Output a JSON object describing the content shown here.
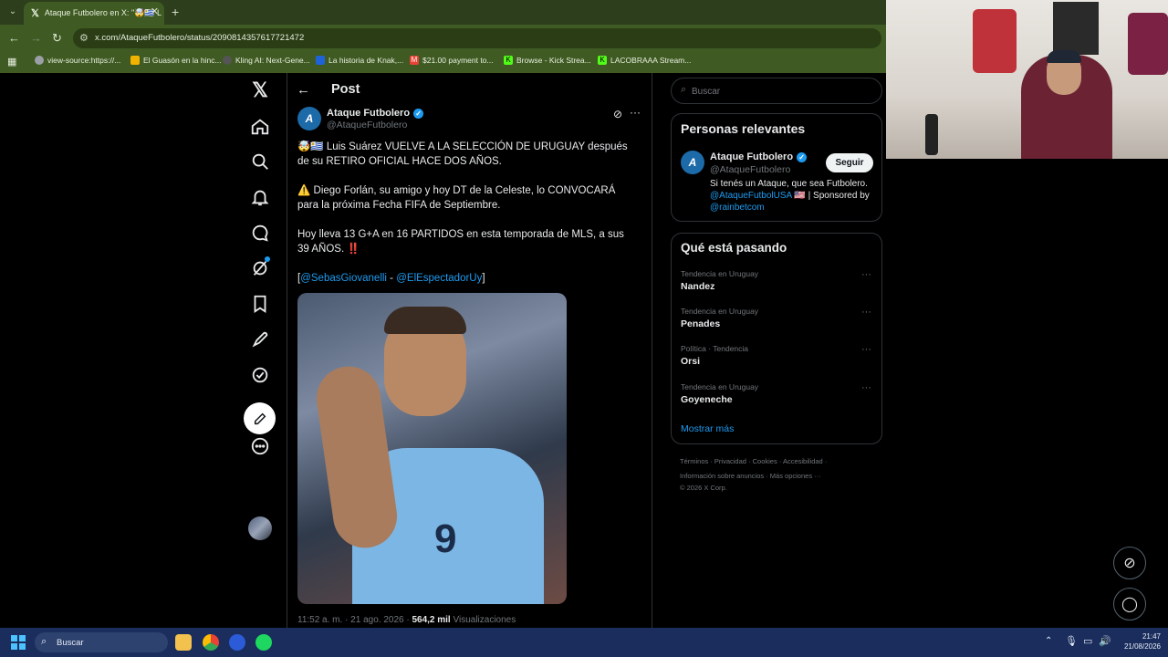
{
  "browser": {
    "tab_title": "Ataque Futbolero en X: \"🤯🇺🇾 L",
    "url": "x.com/AtaqueFutbolero/status/2090814357617721472",
    "bookmarks": [
      {
        "label": "view-source:https://...",
        "icon_color": "#9aa0a6"
      },
      {
        "label": "El Guasón en la hinc...",
        "icon_color": "#f0b400"
      },
      {
        "label": "Kling AI: Next-Gene...",
        "icon_color": "#e8eaed"
      },
      {
        "label": "La historia de Knak,...",
        "icon_color": "#1e63d8"
      },
      {
        "label": "$21.00 payment to...",
        "icon_color": "#ea4335"
      },
      {
        "label": "Browse - Kick Strea...",
        "icon_color": "#53fc18"
      },
      {
        "label": "LACOBRAAA Stream...",
        "icon_color": "#53fc18"
      }
    ]
  },
  "post_header": {
    "title": "Post"
  },
  "author": {
    "name": "Ataque Futbolero",
    "handle": "@AtaqueFutbolero",
    "avatar_initial": "A"
  },
  "post": {
    "line1": "🤯🇺🇾 Luis Suárez VUELVE A LA SELECCIÓN DE URUGUAY después de su RETIRO OFICIAL HACE DOS AÑOS.",
    "line2": "⚠️ Diego Forlán, su amigo y hoy DT de la Celeste, lo CONVOCARÁ para la próxima Fecha FIFA de Septiembre.",
    "line3": "Hoy lleva 13 G+A en 16 PARTIDOS en esta temporada de MLS, a sus 39 AÑOS. ‼️",
    "mention_open": "[",
    "mention1": "@SebasGiovanelli",
    "mention_sep": " - ",
    "mention2": "@ElEspectadorUy",
    "mention_close": "]",
    "jersey_number": "9",
    "time_date": "11:52 a. m. · 21 ago. 2026 · ",
    "views_count": "564,2 mil",
    "views_label": " Visualizaciones"
  },
  "search": {
    "placeholder": "Buscar"
  },
  "relevant": {
    "heading": "Personas relevantes",
    "name": "Ataque Futbolero",
    "handle": "@AtaqueFutbolero",
    "follow_label": "Seguir",
    "bio_text": "Si tenés un Ataque, que sea Futbolero.",
    "bio_link1": "@AtaqueFutbolUSA",
    "bio_mid": " 🇺🇸 | Sponsored by ",
    "bio_link2": "@rainbetcom"
  },
  "trending": {
    "heading": "Qué está pasando",
    "items": [
      {
        "category": "Tendencia en Uruguay",
        "name": "Nandez"
      },
      {
        "category": "Tendencia en Uruguay",
        "name": "Penades"
      },
      {
        "category": "Política · Tendencia",
        "name": "Orsi"
      },
      {
        "category": "Tendencia en Uruguay",
        "name": "Goyeneche"
      }
    ],
    "show_more": "Mostrar más"
  },
  "footer": {
    "line1": "Términos  ·  Privacidad  ·  Cookies  ·  Accesibilidad  ·",
    "line2": "Información sobre anuncios  ·  Más opciones ···",
    "line3": "© 2026 X Corp."
  },
  "taskbar": {
    "search_placeholder": "Buscar",
    "time": "21:47",
    "date": "21/08/2026"
  },
  "colors": {
    "accent": "#1d9bf0",
    "browser_frame": "#3f5a22",
    "taskbar": "#1a2d5c"
  }
}
